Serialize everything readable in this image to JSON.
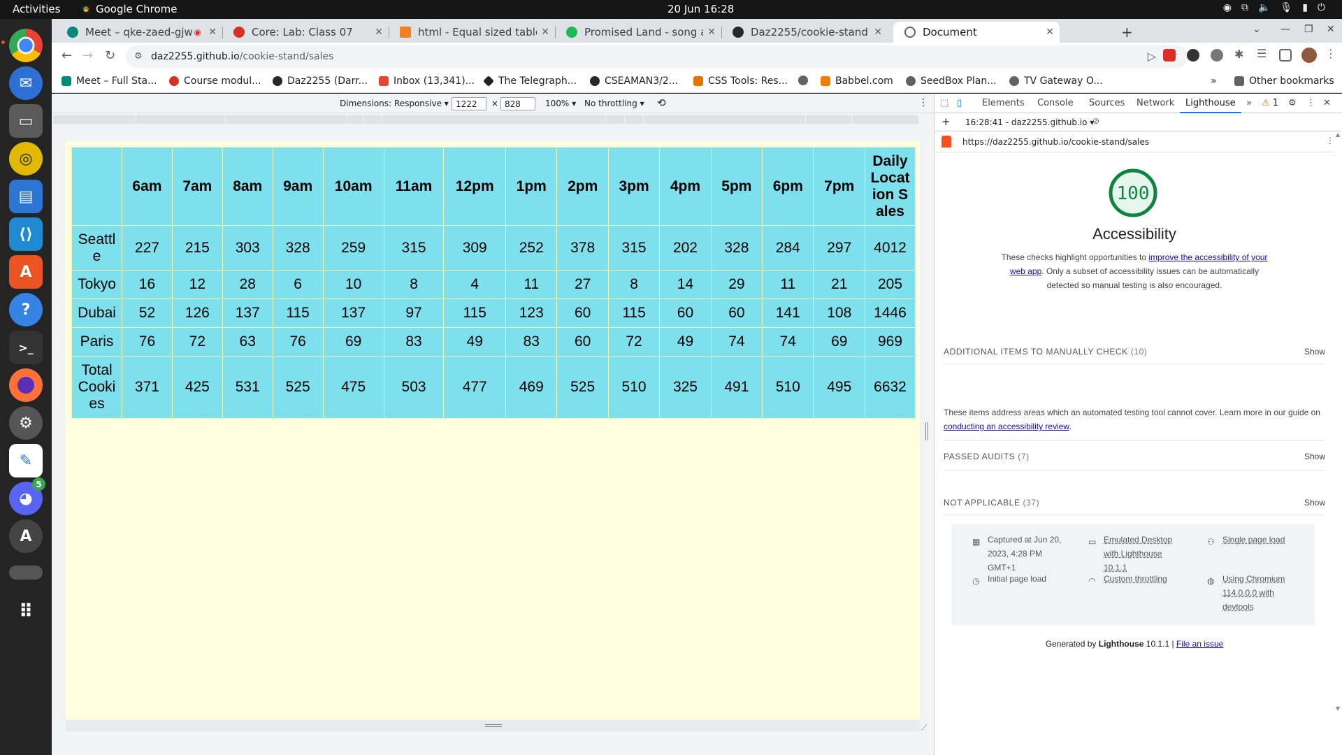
{
  "topbar": {
    "activities": "Activities",
    "app_name": "Google Chrome",
    "datetime": "20 Jun  16:28"
  },
  "dock": {
    "items": [
      "chrome-icon",
      "thunderbird-icon",
      "files-icon",
      "rhythmbox-icon",
      "writer-icon",
      "vscode-icon",
      "app-center-icon",
      "help-icon",
      "terminal-icon",
      "firefox-icon",
      "settings-icon",
      "text-editor-icon",
      "discord-icon",
      "software-updater-icon",
      "trash-icon",
      "app-grid-icon"
    ],
    "discord_badge": "5"
  },
  "tabs": [
    {
      "title": "Meet – qke-zaed-gjw",
      "color": "#00897b"
    },
    {
      "title": "Core: Lab: Class 07",
      "color": "#d93025"
    },
    {
      "title": "html - Equal sized table ce",
      "color": "#f48024"
    },
    {
      "title": "Promised Land - song and",
      "color": "#1db954"
    },
    {
      "title": "Daz2255/cookie-stand",
      "color": "#24292f"
    },
    {
      "title": "Document",
      "color": "#5f6368"
    }
  ],
  "omnibox": {
    "host": "daz2255.github.io",
    "path": "/cookie-stand/sales"
  },
  "bookmarks": [
    {
      "label": "Meet – Full Sta...",
      "color": "#00897b"
    },
    {
      "label": "Course modul...",
      "color": "#d93025"
    },
    {
      "label": "Daz2255 (Darr...",
      "color": "#24292f"
    },
    {
      "label": "Inbox (13,341)...",
      "color": "#ea4335"
    },
    {
      "label": "The Telegraph...",
      "color": "#202124"
    },
    {
      "label": "CSEAMAN3/2...",
      "color": "#24292f"
    },
    {
      "label": "CSS Tools: Res...",
      "color": "#e37400"
    },
    {
      "label": "",
      "color": "#5f6368"
    },
    {
      "label": "Babbel.com",
      "color": "#f57c00"
    },
    {
      "label": "SeedBox Plan...",
      "color": "#5f6368"
    },
    {
      "label": "TV Gateway O...",
      "color": "#5f6368"
    }
  ],
  "bookmarks_more": "»",
  "other_bookmarks": "Other bookmarks",
  "device_toolbar": {
    "dimensions": "Dimensions: Responsive ▾",
    "width": "1222",
    "times": "×",
    "height": "828",
    "zoom": "100% ▾",
    "throttling": "No throttling ▾"
  },
  "sales_table": {
    "headers": [
      "",
      "6am",
      "7am",
      "8am",
      "9am",
      "10am",
      "11am",
      "12pm",
      "1pm",
      "2pm",
      "3pm",
      "4pm",
      "5pm",
      "6pm",
      "7pm",
      "Daily Location Sales"
    ],
    "rows": [
      {
        "label": "Seattle",
        "values": [
          "227",
          "215",
          "303",
          "328",
          "259",
          "315",
          "309",
          "252",
          "378",
          "315",
          "202",
          "328",
          "284",
          "297",
          "4012"
        ]
      },
      {
        "label": "Tokyo",
        "values": [
          "16",
          "12",
          "28",
          "6",
          "10",
          "8",
          "4",
          "11",
          "27",
          "8",
          "14",
          "29",
          "11",
          "21",
          "205"
        ]
      },
      {
        "label": "Dubai",
        "values": [
          "52",
          "126",
          "137",
          "115",
          "137",
          "97",
          "115",
          "123",
          "60",
          "115",
          "60",
          "60",
          "141",
          "108",
          "1446"
        ]
      },
      {
        "label": "Paris",
        "values": [
          "76",
          "72",
          "63",
          "76",
          "69",
          "83",
          "49",
          "83",
          "60",
          "72",
          "49",
          "74",
          "74",
          "69",
          "969"
        ]
      }
    ],
    "total": {
      "label": "Total Cookies",
      "values": [
        "371",
        "425",
        "531",
        "525",
        "475",
        "503",
        "477",
        "469",
        "525",
        "510",
        "325",
        "491",
        "510",
        "495",
        "6632"
      ]
    }
  },
  "devtools": {
    "tabs": [
      "Elements",
      "Console",
      "Sources",
      "Network",
      "Lighthouse"
    ],
    "more": "»",
    "warning_count": "1",
    "report_label": "16:28:41 - daz2255.github.io ▾",
    "report_url": "https://daz2255.github.io/cookie-stand/sales"
  },
  "lighthouse": {
    "score": 100,
    "score_color": "#0c843e",
    "category": "Accessibility",
    "desc_pre": "These checks highlight opportunities to ",
    "desc_link": "improve the accessibility of your web app",
    "desc_post": ". Only a subset of accessibility issues can be automatically detected so manual testing is also encouraged.",
    "groups": {
      "manual": {
        "title": "ADDITIONAL ITEMS TO MANUALLY CHECK",
        "count": "(10)",
        "show": "Show"
      },
      "passed": {
        "title": "PASSED AUDITS",
        "count": "(7)",
        "show": "Show"
      },
      "na": {
        "title": "NOT APPLICABLE",
        "count": "(37)",
        "show": "Show"
      }
    },
    "manual_desc_pre": "These items address areas which an automated testing tool cannot cover. Learn more in our guide on ",
    "manual_desc_link": "conducting an accessibility review",
    "manual_desc_post": ".",
    "meta": {
      "captured": "Captured at Jun 20, 2023, 4:28 PM GMT+1",
      "initial": "Initial page load",
      "emulated": "Emulated Desktop with Lighthouse 10.1.1",
      "throttling": "Custom throttling",
      "single": "Single page load",
      "chromium": "Using Chromium 114.0.0.0 with devtools"
    },
    "generated_pre": "Generated by ",
    "generated_bold": "Lighthouse",
    "generated_ver": " 10.1.1 | ",
    "file_issue": "File an issue"
  }
}
